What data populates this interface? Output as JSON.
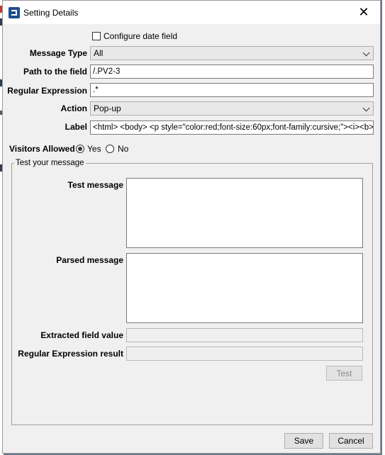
{
  "window": {
    "title": "Setting Details",
    "close_icon": "close-icon"
  },
  "configure_date": {
    "label": "Configure date field",
    "checked": false
  },
  "form": {
    "message_type": {
      "label": "Message Type",
      "value": "All"
    },
    "path": {
      "label": "Path to the field",
      "value": "/.PV2-3"
    },
    "regex": {
      "label": "Regular Expression",
      "value": ".*"
    },
    "action": {
      "label": "Action",
      "value": "Pop-up"
    },
    "label": {
      "label": "Label",
      "value": "<html> <body> <p style=\"color:red;font-size:60px;font-family:cursive;\"><i><b>"
    },
    "visitors": {
      "label": "Visitors Allowed",
      "yes": "Yes",
      "no": "No",
      "selected": "Yes"
    }
  },
  "test_group": {
    "title": "Test your message",
    "test_message_label": "Test message",
    "parsed_message_label": "Parsed message",
    "extracted_label": "Extracted field value",
    "regex_result_label": "Regular Expression result",
    "test_button": "Test"
  },
  "footer": {
    "save": "Save",
    "cancel": "Cancel"
  },
  "colors": {
    "app_icon": "#1e4e8c",
    "window_bg": "#f0f0f0"
  }
}
